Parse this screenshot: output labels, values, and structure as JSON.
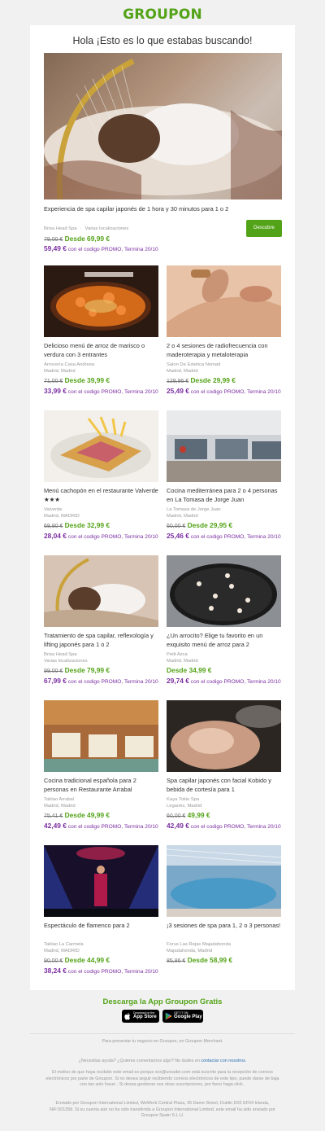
{
  "brand": {
    "logo_text": "GROUPON",
    "color": "#53a318"
  },
  "greeting": "Hola ¡Esto es lo que estabas buscando!",
  "hero": {
    "title": "Experiencia de spa capilar japonés de 1 hora y 30 minutos para 1 o 2",
    "merchant": "Brisa Head Spa",
    "location": "Varias localizaciones",
    "old_price": "79,00 €",
    "new_price": "Desde 69,99 €",
    "promo_price": "59,49 €",
    "promo_text": "con el codigo PROMO, Termina 20/10",
    "cta": "Descubre"
  },
  "deals": [
    {
      "title": "Delicioso menú de arroz de marisco o verdura con 3 entrantes",
      "merchant": "Arrocería Casa Andreea",
      "location": "Madrid, Madrid",
      "old_price": "71,00 €",
      "new_price": "Desde 39,99 €",
      "promo_price": "33,99 €",
      "promo_text": "con el codigo PROMO, Termina 20/10",
      "image": "paella"
    },
    {
      "title": "2 o 4 sesiones de radiofrecuencia con maderoterapia y metaloterapia",
      "merchant": "Salon De Estetica Nomad",
      "location": "Madrid, Madrid",
      "old_price": "129,96 €",
      "new_price": "Desde 29,99 €",
      "promo_price": "25,49 €",
      "promo_text": "con el codigo PROMO, Termina 20/10",
      "image": "massage"
    },
    {
      "title": "Menú cachopón en el restaurante Valverde ★★★",
      "merchant": "Valverde",
      "location": "Madrid, MADRID",
      "old_price": "69,90 €",
      "new_price": "Desde 32,99 €",
      "promo_price": "28,04 €",
      "promo_text": "con el codigo PROMO, Termina 20/10",
      "image": "cachopo"
    },
    {
      "title": "Cocina mediterránea para 2 o 4 personas en La Tomasa de Jorge Juan",
      "merchant": "La Tomasa de Jorge Juan",
      "location": "Madrid, Madrid",
      "old_price": "60,00 €",
      "new_price": "Desde 29,95 €",
      "promo_price": "25,46 €",
      "promo_text": "con el codigo PROMO, Termina 20/10",
      "image": "restaurant"
    },
    {
      "title": "Tratamiento de spa capilar, reflexología y lifting japonés para 1 o 2",
      "merchant": "Brisa Head Spa",
      "location": "Varias localizaciones",
      "old_price": "99,00 €",
      "new_price": "Desde 79,99 €",
      "promo_price": "67,99 €",
      "promo_text": "con el codigo PROMO, Termina 20/10",
      "image": "spa"
    },
    {
      "title": "¿Un arrocito? Elige tu favorito en un exquisito menú de arroz para 2",
      "merchant": "Petit Azca",
      "location": "Madrid, Madrid",
      "old_price": "",
      "new_price": "Desde 34,99 €",
      "promo_price": "29,74 €",
      "promo_text": "con el codigo PROMO, Termina 20/10",
      "image": "blackrice"
    },
    {
      "title": "Cocina tradicional española para 2 personas en Restaurante Arrabal",
      "merchant": "Tablao Arrabal",
      "location": "Madrid, Madrid",
      "old_price": "75,41 €",
      "new_price": "Desde 49,99 €",
      "promo_price": "42,49 €",
      "promo_text": "con el codigo PROMO, Termina 20/10",
      "image": "dining"
    },
    {
      "title": "Spa capilar japonés con facial Kobido y bebida de cortesía para 1",
      "merchant": "Kaya Tokio Spa",
      "location": "Leganés, Madrid",
      "old_price": "60,00 €",
      "new_price": "49,99 €",
      "promo_price": "42,49 €",
      "promo_text": "con el codigo PROMO, Termina 20/10",
      "image": "facial"
    },
    {
      "title": "Espectáculo de flamenco para 2",
      "merchant": "Tablao La Carmela",
      "location": "Madrid, MADRID",
      "old_price": "90,00 €",
      "new_price": "Desde 44,99 €",
      "promo_price": "38,24 €",
      "promo_text": "con el codigo PROMO, Termina 20/10",
      "image": "flamenco"
    },
    {
      "title": "¡3 sesiones de spa para 1, 2 o 3 personas!",
      "merchant": "Forus Las Rejas Majadahonda",
      "location": "Majadahonda, Madrid",
      "old_price": "85,86 €",
      "new_price": "Desde 58,99 €",
      "promo_price": "",
      "promo_text": "",
      "image": "pool"
    }
  ],
  "footer": {
    "app_title": "Descarga la App Groupon Gratis",
    "app_store_small": "Download on the",
    "app_store": "App Store",
    "google_play_small": "GET IT ON",
    "google_play": "Google Play",
    "merchant_line": "Para presentar tu negocio en Groupon, en Groupon Merchant.",
    "help_text": "¿Necesitas ayuda? ¿Quieres comentarnos algo? No dudes en",
    "help_link": "contactar con nosotros.",
    "reason": "El motivo de que haya recibido este email es porque xxx@ureader.com está suscrito para la recepción de correos electrónicos por parte de Groupon. Si no desea seguir recibiendo correos electrónicos de este tipo, puede darse de baja con tan solo hacer . Si desea gestionar sus otras suscripciones, por favor haga click .",
    "legal": "Enviado por Groupon International Limited, WeWork Central Plaza, 36 Dame Street, Dublin D02 EF64 Irlanda, NIF:501358. Si su cuenta aún no ha sido transferida a Groupon International Limited, este email ha sido enviado por Groupon Spain S.L.U."
  }
}
